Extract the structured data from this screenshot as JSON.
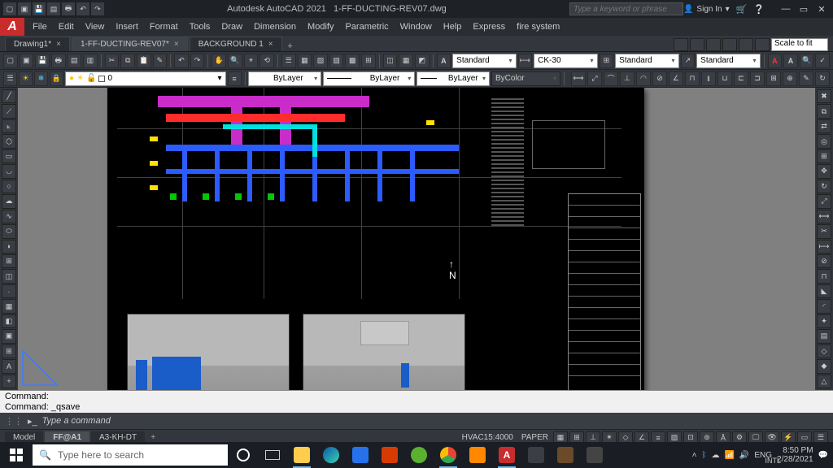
{
  "title": {
    "app": "Autodesk AutoCAD 2021",
    "file": "1-FF-DUCTING-REV07.dwg"
  },
  "search_placeholder": "Type a keyword or phrase",
  "signin": "Sign In",
  "menu": [
    "File",
    "Edit",
    "View",
    "Insert",
    "Format",
    "Tools",
    "Draw",
    "Dimension",
    "Modify",
    "Parametric",
    "Window",
    "Help",
    "Express",
    "fire system"
  ],
  "scalefit": "Scale to fit",
  "file_tabs": [
    {
      "label": "Drawing1*",
      "active": false
    },
    {
      "label": "1-FF-DUCTING-REV07*",
      "active": true
    },
    {
      "label": "BACKGROUND 1",
      "active": false
    }
  ],
  "dropdowns": {
    "textstyle1": "Standard",
    "dimstyle": "CK-30",
    "tablestyle": "Standard",
    "mlstyle": "Standard",
    "layer_linetype": "ByLayer",
    "layer_lineweight": "ByLayer",
    "layer_plotstyle": "ByLayer",
    "layer_color": "ByColor",
    "current_layer": "0"
  },
  "command": {
    "hist1": "Command:",
    "hist2": "Command: _qsave",
    "prompt": "Type a command"
  },
  "layout_tabs": [
    "Model",
    "FF@A1",
    "A3-KH-DT"
  ],
  "status": {
    "scale": "HVAC15:4000",
    "space": "PAPER"
  },
  "taskbar": {
    "search": "Type here to search",
    "lang1": "ENG",
    "lang2": "INTL",
    "time": "8:50 PM",
    "date": "2/28/2021"
  },
  "north_label": "N"
}
